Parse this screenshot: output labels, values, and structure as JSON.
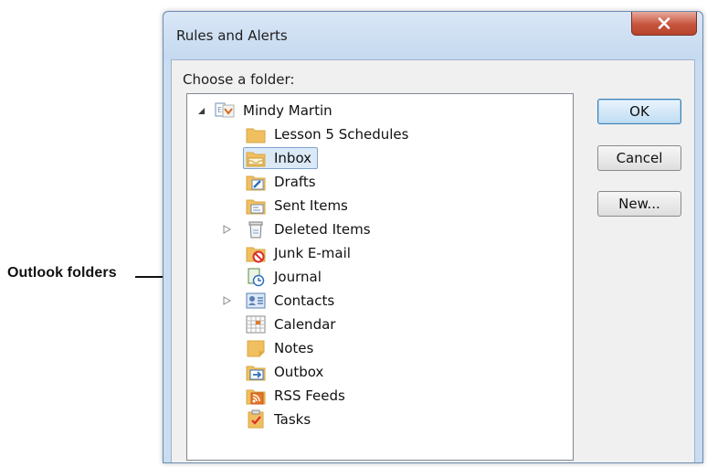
{
  "callout": {
    "text": "Outlook folders"
  },
  "dialog": {
    "title": "Rules and Alerts",
    "choose_label": "Choose a folder:",
    "buttons": {
      "ok": "OK",
      "cancel": "Cancel",
      "new": "New..."
    }
  },
  "tree": {
    "root": {
      "label": "Mindy Martin",
      "icon": "mailbox-icon",
      "expanded": true
    },
    "folders": [
      {
        "label": "Lesson 5 Schedules",
        "icon": "folder-icon",
        "expandable": false,
        "selected": false
      },
      {
        "label": "Inbox",
        "icon": "inbox-icon",
        "expandable": false,
        "selected": true
      },
      {
        "label": "Drafts",
        "icon": "drafts-icon",
        "expandable": false,
        "selected": false
      },
      {
        "label": "Sent Items",
        "icon": "sent-items-icon",
        "expandable": false,
        "selected": false
      },
      {
        "label": "Deleted Items",
        "icon": "deleted-items-icon",
        "expandable": true,
        "selected": false
      },
      {
        "label": "Junk E-mail",
        "icon": "junk-email-icon",
        "expandable": false,
        "selected": false
      },
      {
        "label": "Journal",
        "icon": "journal-icon",
        "expandable": false,
        "selected": false
      },
      {
        "label": "Contacts",
        "icon": "contacts-icon",
        "expandable": true,
        "selected": false
      },
      {
        "label": "Calendar",
        "icon": "calendar-icon",
        "expandable": false,
        "selected": false
      },
      {
        "label": "Notes",
        "icon": "notes-icon",
        "expandable": false,
        "selected": false
      },
      {
        "label": "Outbox",
        "icon": "outbox-icon",
        "expandable": false,
        "selected": false
      },
      {
        "label": "RSS Feeds",
        "icon": "rss-feeds-icon",
        "expandable": false,
        "selected": false
      },
      {
        "label": "Tasks",
        "icon": "tasks-icon",
        "expandable": false,
        "selected": false
      }
    ]
  },
  "colors": {
    "folder": "#f0c060",
    "selection": "#dbe9f7",
    "close_button": "#c7553e",
    "accent_blue": "#3c7fb1"
  }
}
